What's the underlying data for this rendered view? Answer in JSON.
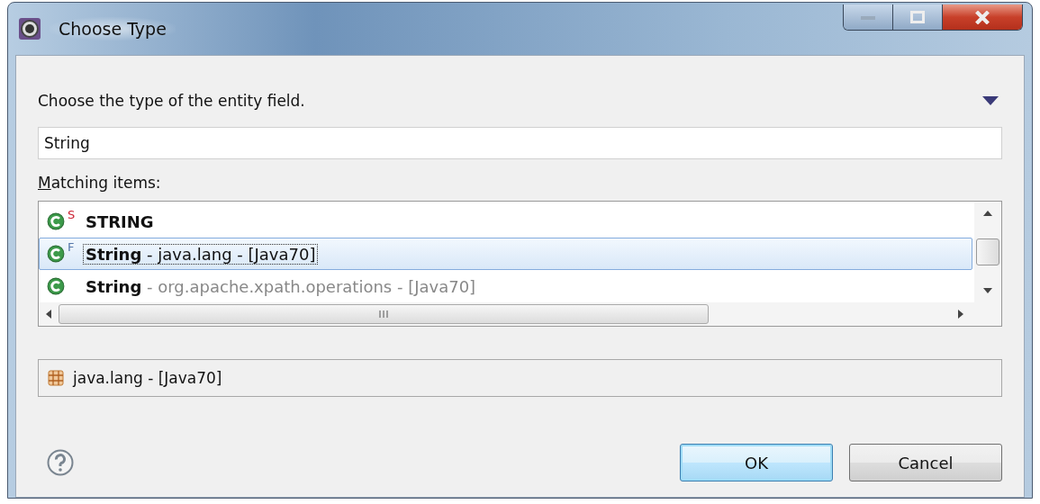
{
  "window": {
    "title": "Choose Type"
  },
  "instruction": "Choose the type of the entity field.",
  "filter": {
    "value": "String"
  },
  "list_label": {
    "mnemonic": "M",
    "rest": "atching items:"
  },
  "items": [
    {
      "decorator": "S",
      "color": "#cc2233",
      "name": "STRING",
      "selected": false
    },
    {
      "decorator": "F",
      "color": "#5577aa",
      "name": "String",
      "detail": " - java.lang - [Java70]",
      "dimmed": false,
      "selected": true
    },
    {
      "name": "String",
      "detail": " - org.apache.xpath.operations - [Java70]",
      "dimmed": true,
      "selected": false
    }
  ],
  "details": {
    "text": "java.lang - [Java70]"
  },
  "buttons": [
    {
      "label": "OK",
      "default": true
    },
    {
      "label": "Cancel",
      "default": false
    }
  ]
}
